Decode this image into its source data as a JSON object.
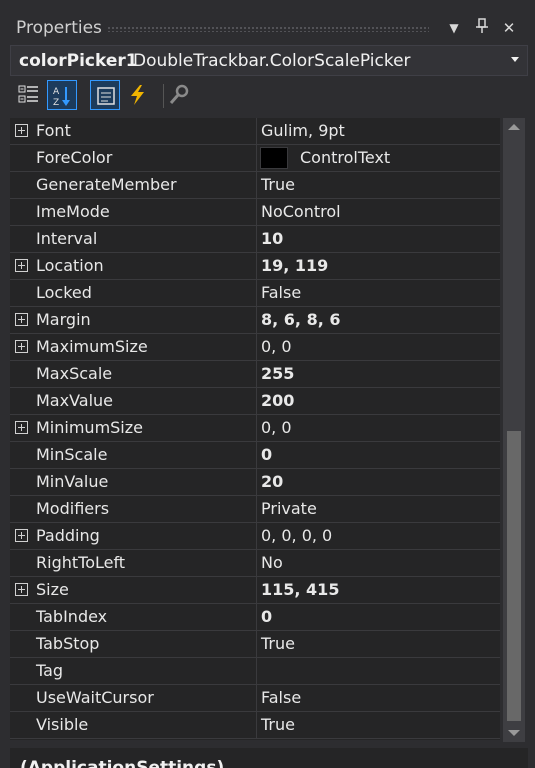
{
  "window": {
    "title": "Properties",
    "buttons": [
      {
        "icon": "dropdown-arrow-icon",
        "glyph": "▼"
      },
      {
        "icon": "pin-icon",
        "glyph": "⊥"
      },
      {
        "icon": "close-icon",
        "glyph": "✕"
      }
    ]
  },
  "object_selector": {
    "name": "colorPicker1",
    "type": "DoubleTrackbar.ColorScalePicker"
  },
  "toolbar": {
    "tools": [
      {
        "icon": "categorized-icon",
        "active": false
      },
      {
        "icon": "alphabetical-icon",
        "active": true
      },
      {
        "icon": "properties-icon",
        "active": true
      },
      {
        "icon": "events-icon",
        "active": false
      },
      {
        "icon": "property-pages-icon",
        "active": false
      }
    ]
  },
  "properties": [
    {
      "name": "Font",
      "value": "Gulim, 9pt",
      "expandable": true,
      "bold": false
    },
    {
      "name": "ForeColor",
      "value": "ControlText",
      "expandable": false,
      "bold": false,
      "swatch": "#000000"
    },
    {
      "name": "GenerateMember",
      "value": "True",
      "expandable": false,
      "bold": false
    },
    {
      "name": "ImeMode",
      "value": "NoControl",
      "expandable": false,
      "bold": false
    },
    {
      "name": "Interval",
      "value": "10",
      "expandable": false,
      "bold": true
    },
    {
      "name": "Location",
      "value": "19, 119",
      "expandable": true,
      "bold": true
    },
    {
      "name": "Locked",
      "value": "False",
      "expandable": false,
      "bold": false
    },
    {
      "name": "Margin",
      "value": "8, 6, 8, 6",
      "expandable": true,
      "bold": true
    },
    {
      "name": "MaximumSize",
      "value": "0, 0",
      "expandable": true,
      "bold": false
    },
    {
      "name": "MaxScale",
      "value": "255",
      "expandable": false,
      "bold": true
    },
    {
      "name": "MaxValue",
      "value": "200",
      "expandable": false,
      "bold": true
    },
    {
      "name": "MinimumSize",
      "value": "0, 0",
      "expandable": true,
      "bold": false
    },
    {
      "name": "MinScale",
      "value": "0",
      "expandable": false,
      "bold": true
    },
    {
      "name": "MinValue",
      "value": "20",
      "expandable": false,
      "bold": true
    },
    {
      "name": "Modifiers",
      "value": "Private",
      "expandable": false,
      "bold": false
    },
    {
      "name": "Padding",
      "value": "0, 0, 0, 0",
      "expandable": true,
      "bold": false
    },
    {
      "name": "RightToLeft",
      "value": "No",
      "expandable": false,
      "bold": false
    },
    {
      "name": "Size",
      "value": "115, 415",
      "expandable": true,
      "bold": true
    },
    {
      "name": "TabIndex",
      "value": "0",
      "expandable": false,
      "bold": true
    },
    {
      "name": "TabStop",
      "value": "True",
      "expandable": false,
      "bold": false
    },
    {
      "name": "Tag",
      "value": "",
      "expandable": false,
      "bold": false
    },
    {
      "name": "UseWaitCursor",
      "value": "False",
      "expandable": false,
      "bold": false
    },
    {
      "name": "Visible",
      "value": "True",
      "expandable": false,
      "bold": false
    }
  ],
  "description": {
    "title": "(ApplicationSettings)"
  }
}
